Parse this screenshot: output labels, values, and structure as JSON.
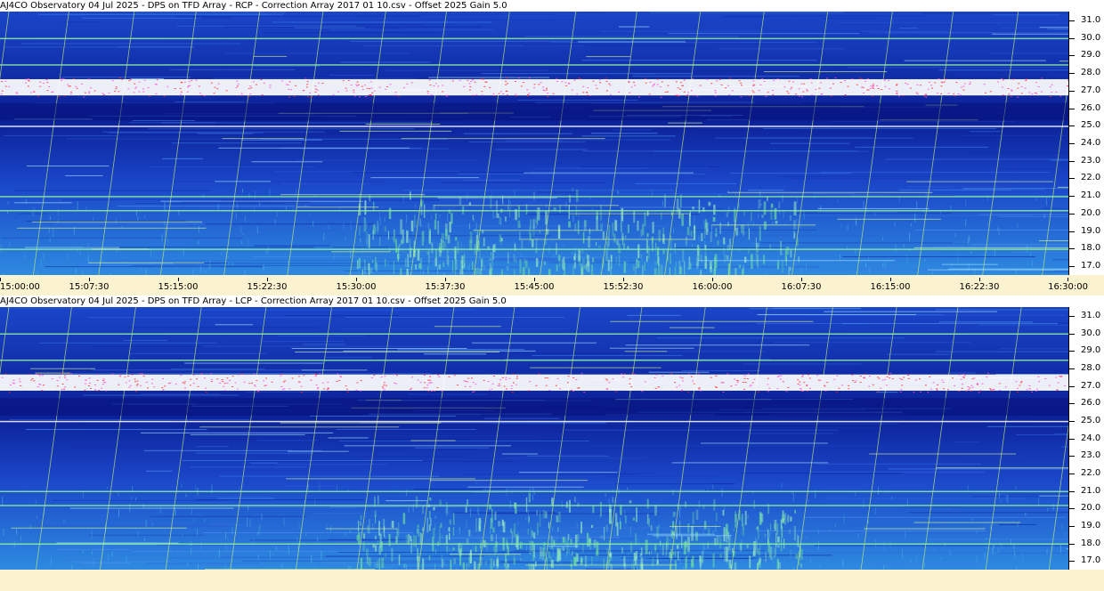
{
  "chart_data": [
    {
      "type": "heatmap",
      "title": "AJ4CO Observatory 04 Jul 2025  -  DPS on TFD Array  -  RCP  -  Correction Array 2017 01 10.csv  -  Offset 2025  Gain 5.0",
      "xlabel": "",
      "ylabel": "",
      "x_ticks": [
        "15:00:00",
        "15:07:30",
        "15:15:00",
        "15:22:30",
        "15:30:00",
        "15:37:30",
        "15:45:00",
        "15:52:30",
        "16:00:00",
        "16:07:30",
        "16:15:00",
        "16:22:30",
        "16:30:00"
      ],
      "y_ticks": [
        "31.0",
        "30.0",
        "29.0",
        "28.0",
        "27.0",
        "26.0",
        "25.0",
        "24.0",
        "23.0",
        "22.0",
        "21.0",
        "20.0",
        "19.0",
        "18.0",
        "17.0"
      ],
      "y_range_mhz": [
        16.5,
        31.5
      ],
      "grid": false,
      "features": {
        "strong_interference_band_mhz": 27.2,
        "interference_lines_mhz": [
          30.0,
          28.5,
          26.8,
          25.0,
          21.0,
          20.2,
          18.0
        ],
        "burst_region": {
          "time_start": "15:30:00",
          "time_end": "16:07:30",
          "freq_low_mhz": 16.8,
          "freq_high_mhz": 21.5
        }
      }
    },
    {
      "type": "heatmap",
      "title": "AJ4CO Observatory 04 Jul 2025  -  DPS on TFD Array  -  LCP  -  Correction Array 2017 01 10.csv  -  Offset 2025  Gain 5.0",
      "xlabel": "",
      "ylabel": "",
      "x_ticks": [],
      "y_ticks": [
        "31.0",
        "30.0",
        "29.0",
        "28.0",
        "27.0",
        "26.0",
        "25.0",
        "24.0",
        "23.0",
        "22.0",
        "21.0",
        "20.0",
        "19.0",
        "18.0",
        "17.0"
      ],
      "y_range_mhz": [
        16.5,
        31.5
      ],
      "grid": false,
      "features": {
        "strong_interference_band_mhz": 27.2,
        "interference_lines_mhz": [
          30.0,
          28.5,
          26.8,
          25.0,
          21.0,
          20.2,
          18.0
        ],
        "burst_region": {
          "time_start": "15:30:00",
          "time_end": "16:07:30",
          "freq_low_mhz": 16.8,
          "freq_high_mhz": 21.0
        }
      }
    }
  ],
  "colors": {
    "background_deep": "#0b1f96",
    "background_mid": "#1a46c8",
    "low_band": "#2e8ae0",
    "interference": "#ffffff",
    "burst": "#6fe0a0",
    "axis_bg": "#fbf2d0"
  }
}
